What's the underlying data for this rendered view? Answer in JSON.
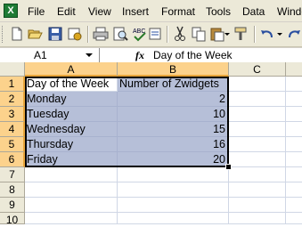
{
  "app": {
    "icon": "excel-icon"
  },
  "menu": [
    "File",
    "Edit",
    "View",
    "Insert",
    "Format",
    "Tools",
    "Data",
    "Windo"
  ],
  "toolbar": {
    "buttons": [
      "new-icon",
      "open-icon",
      "save-icon",
      "permission-icon",
      "print-icon",
      "print-preview-icon",
      "spelling-icon",
      "research-icon",
      "cut-icon",
      "copy-icon",
      "paste-icon",
      "format-painter-icon",
      "undo-icon",
      "redo-icon"
    ]
  },
  "formula_bar": {
    "name_box": "A1",
    "fx_label": "fx",
    "formula": "Day of the Week"
  },
  "sheet": {
    "columns": [
      "A",
      "B",
      "C"
    ],
    "rows": [
      "1",
      "2",
      "3",
      "4",
      "5",
      "6",
      "7",
      "8",
      "9",
      "10"
    ],
    "cells": [
      [
        "Day of the Week",
        "Number of Zwidgets",
        ""
      ],
      [
        "Monday",
        "2",
        ""
      ],
      [
        "Tuesday",
        "10",
        ""
      ],
      [
        "Wednesday",
        "15",
        ""
      ],
      [
        "Thursday",
        "16",
        ""
      ],
      [
        "Friday",
        "20",
        ""
      ],
      [
        "",
        "",
        ""
      ],
      [
        "",
        "",
        ""
      ],
      [
        "",
        "",
        ""
      ],
      [
        "",
        "",
        ""
      ]
    ],
    "active_cell": "A1",
    "selection": "A1:B6"
  },
  "colors": {
    "selection_fill": "#b6bfd8",
    "header_highlight": "#fcd28c",
    "chrome": "#ece9d8"
  }
}
